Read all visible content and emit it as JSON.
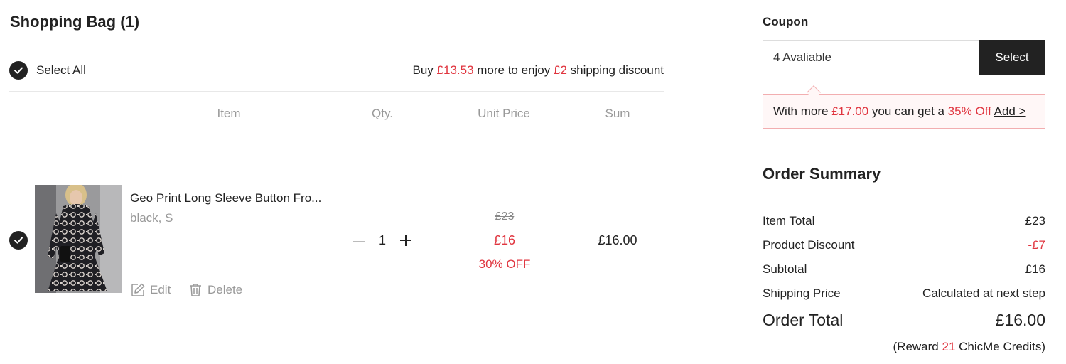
{
  "bag": {
    "title": "Shopping Bag (1)",
    "select_all": "Select All",
    "shipping": {
      "prefix": "Buy ",
      "amount": "£13.53",
      "middle": " more to enjoy ",
      "discount": "£2",
      "suffix": " shipping discount"
    },
    "columns": {
      "item": "Item",
      "qty": "Qty.",
      "unit_price": "Unit Price",
      "sum": "Sum"
    },
    "items": [
      {
        "name": "Geo Print Long Sleeve Button Fro...",
        "variant": "black, S",
        "quantity": "1",
        "original_price": "£23",
        "price": "£16",
        "off": "30% OFF",
        "sum": "£16.00",
        "edit_label": "Edit",
        "delete_label": "Delete",
        "selected": true
      }
    ]
  },
  "coupon": {
    "label": "Coupon",
    "available": "4 Avaliable",
    "button": "Select",
    "promo": {
      "prefix": "With more ",
      "amount": "£17.00",
      "middle": " you can get a ",
      "offer": "35% Off",
      "link": "Add >"
    }
  },
  "summary": {
    "title": "Order Summary",
    "rows": [
      {
        "label": "Item Total",
        "value": "£23"
      },
      {
        "label": "Product Discount",
        "value": "-£7"
      },
      {
        "label": "Subtotal",
        "value": "£16"
      },
      {
        "label": "Shipping Price",
        "value": "Calculated at next step"
      }
    ],
    "total_label": "Order Total",
    "total_value": "£16.00",
    "reward": {
      "prefix": "(Reward ",
      "credits": "21",
      "suffix": " ChicMe Credits)"
    }
  },
  "colors": {
    "accent_red": "#e0353f",
    "dark": "#222222",
    "muted": "#999999"
  }
}
